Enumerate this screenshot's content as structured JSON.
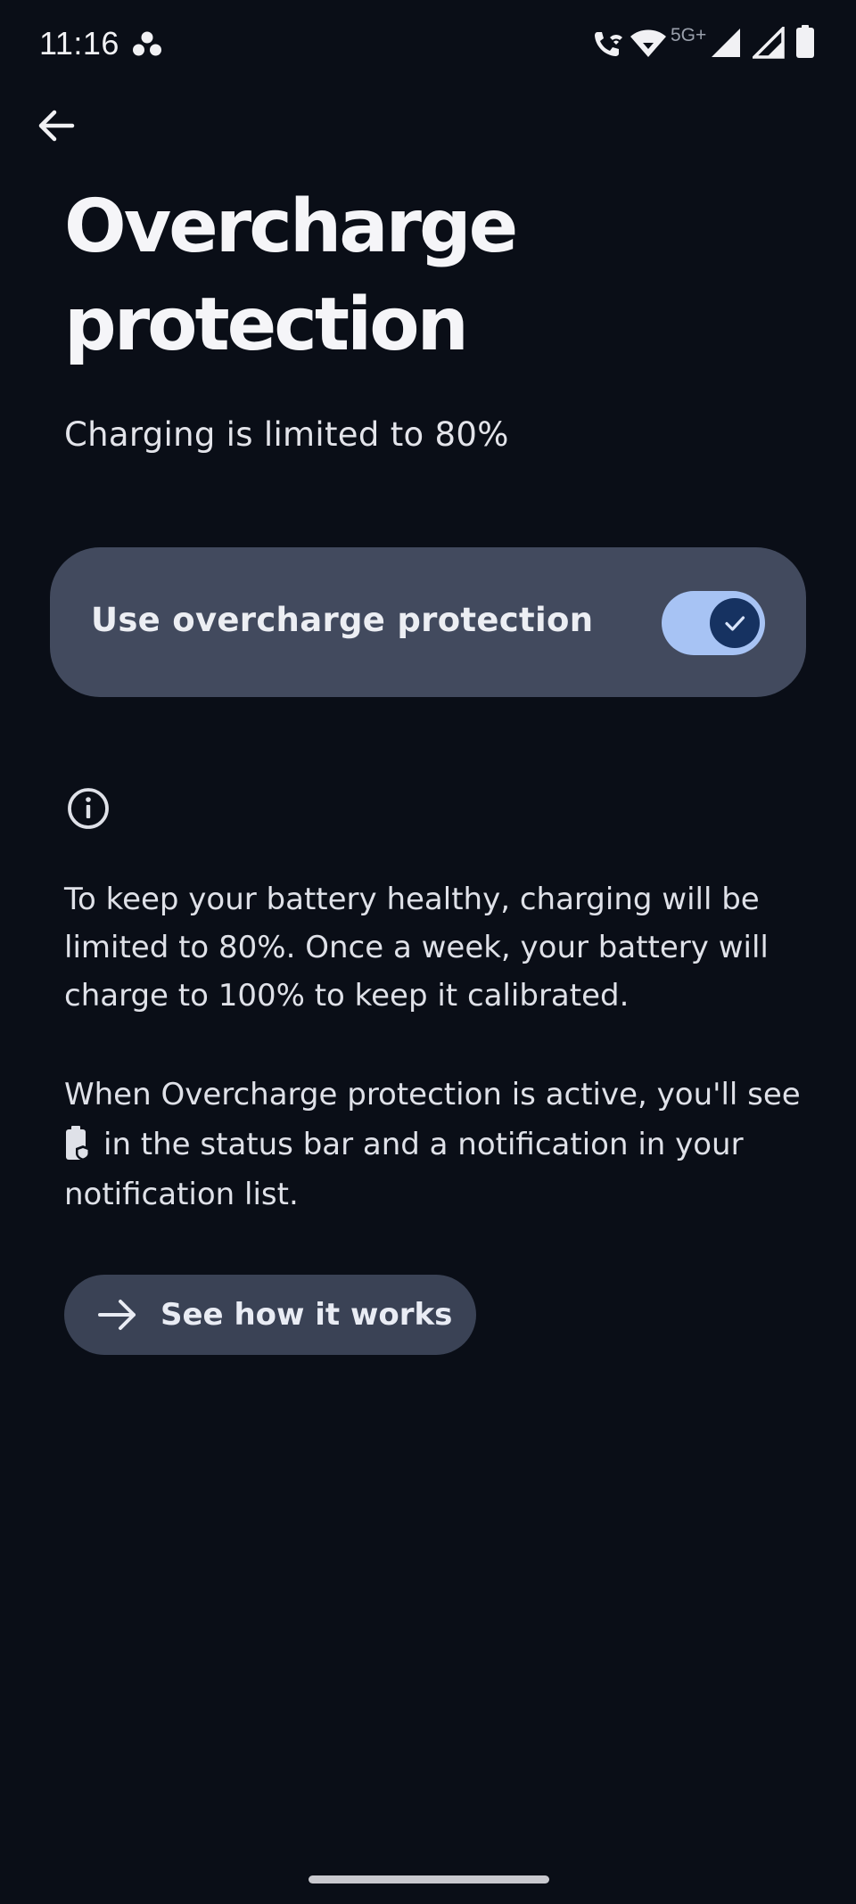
{
  "status_bar": {
    "time": "11:16",
    "network_label": "5G+",
    "icons": [
      "app-notification-icon",
      "wifi-calling-icon",
      "wifi-icon",
      "signal-icon",
      "signal-icon-2",
      "battery-icon"
    ]
  },
  "header": {
    "back_icon": "arrow-back-icon",
    "title": "Overcharge protection"
  },
  "subtitle": "Charging is limited to 80%",
  "toggle": {
    "label": "Use overcharge protection",
    "checked": true
  },
  "info": {
    "icon": "info-icon",
    "paragraph_1": "To keep your battery healthy, charging will be limited to 80%. Once a week, your battery will charge to 100% to keep it calibrated.",
    "paragraph_2_start": "When Overcharge protection is active, you'll see",
    "paragraph_2_end": "in the status bar and a notification in your notification list."
  },
  "action_button": {
    "label": "See how it works",
    "icon": "arrow-forward-icon"
  },
  "colors": {
    "background": "#0a0e17",
    "card": "#424a5e",
    "switch_track": "#a7c3f4",
    "switch_thumb": "#163261",
    "button": "#3a4255"
  }
}
